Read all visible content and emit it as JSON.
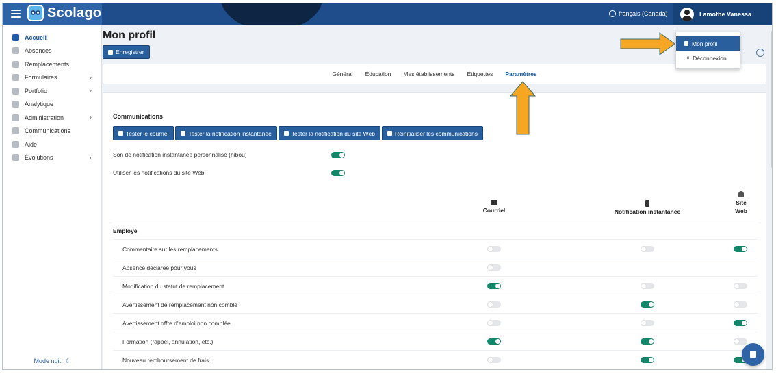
{
  "app": {
    "name": "Scolago"
  },
  "header": {
    "language": "français (Canada)",
    "user_name": "Lamothe Vanessa"
  },
  "sidebar": {
    "items": [
      {
        "label": "Accueil",
        "icon": "home-icon",
        "active": true,
        "has_children": false
      },
      {
        "label": "Absences",
        "icon": "user-absence-icon",
        "active": false,
        "has_children": false
      },
      {
        "label": "Remplacements",
        "icon": "replacement-icon",
        "active": false,
        "has_children": false
      },
      {
        "label": "Formulaires",
        "icon": "form-icon",
        "active": false,
        "has_children": true
      },
      {
        "label": "Portfolio",
        "icon": "trophy-icon",
        "active": false,
        "has_children": true
      },
      {
        "label": "Analytique",
        "icon": "analytics-icon",
        "active": false,
        "has_children": false
      },
      {
        "label": "Administration",
        "icon": "gear-icon",
        "active": false,
        "has_children": true
      },
      {
        "label": "Communications",
        "icon": "megaphone-icon",
        "active": false,
        "has_children": false
      },
      {
        "label": "Aide",
        "icon": "question-icon",
        "active": false,
        "has_children": false
      },
      {
        "label": "Évolutions",
        "icon": "sprout-icon",
        "active": false,
        "has_children": true
      }
    ],
    "night_mode": "Mode nuit"
  },
  "page": {
    "title": "Mon profil",
    "save_label": "Enregistrer"
  },
  "tabs": [
    {
      "label": "Général",
      "active": false
    },
    {
      "label": "Éducation",
      "active": false
    },
    {
      "label": "Mes établissements",
      "active": false
    },
    {
      "label": "Étiquettes",
      "active": false
    },
    {
      "label": "Paramètres",
      "active": true
    }
  ],
  "communications": {
    "title": "Communications",
    "buttons": [
      {
        "label": "Tester le courriel",
        "icon": "envelope-icon"
      },
      {
        "label": "Tester la notification instantanée",
        "icon": "phone-icon"
      },
      {
        "label": "Tester la notification du site Web",
        "icon": "bell-icon"
      },
      {
        "label": "Réinitialiser les communications",
        "icon": "close-icon"
      }
    ],
    "options": [
      {
        "label": "Son de notification instantanée personnalisé (hibou)",
        "on": true
      },
      {
        "label": "Utiliser les notifications du site Web",
        "on": true
      }
    ],
    "columns": [
      {
        "label": "Courriel",
        "icon": "envelope-icon"
      },
      {
        "label": "Notification instantanée",
        "icon": "phone-icon"
      },
      {
        "label": "Site Web",
        "icon": "bell-icon"
      }
    ],
    "group": "Employé",
    "rows": [
      {
        "label": "Commentaire sur les remplacements",
        "courriel": false,
        "instantanee": false,
        "site_web": true
      },
      {
        "label": "Absence déclarée pour vous",
        "courriel": false,
        "instantanee": null,
        "site_web": null
      },
      {
        "label": "Modification du statut de remplacement",
        "courriel": true,
        "instantanee": false,
        "site_web": false
      },
      {
        "label": "Avertissement de remplacement non comblé",
        "courriel": false,
        "instantanee": true,
        "site_web": false
      },
      {
        "label": "Avertissement offre d'emploi non comblée",
        "courriel": false,
        "instantanee": false,
        "site_web": true
      },
      {
        "label": "Formation (rappel, annulation, etc.)",
        "courriel": true,
        "instantanee": true,
        "site_web": false
      },
      {
        "label": "Nouveau remboursement de frais",
        "courriel": false,
        "instantanee": true,
        "site_web": true
      }
    ]
  },
  "user_menu": {
    "items": [
      {
        "label": "Mon profil",
        "icon": "user-icon",
        "active": true
      },
      {
        "label": "Déconnexion",
        "icon": "logout-icon",
        "active": false
      }
    ]
  },
  "colors": {
    "brand": "#1f4d8c",
    "toggle_on": "#13876a",
    "annotation_arrow": "#f5a623"
  }
}
